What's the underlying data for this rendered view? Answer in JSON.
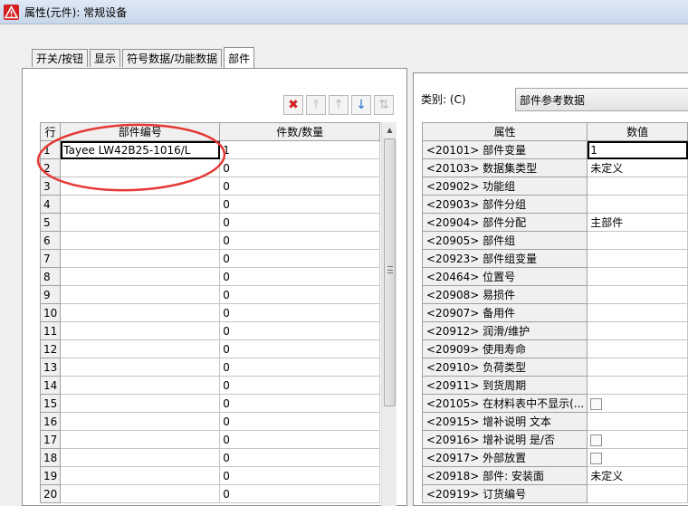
{
  "window": {
    "title": "属性(元件): 常规设备",
    "icon": "warning-triangle-app-icon"
  },
  "tabs": [
    {
      "label": "开关/按钮",
      "active": false
    },
    {
      "label": "显示",
      "active": false
    },
    {
      "label": "符号数据/功能数据",
      "active": false
    },
    {
      "label": "部件",
      "active": true
    }
  ],
  "toolbar": [
    {
      "icon": "delete-icon",
      "glyph": "✖",
      "enabled": true
    },
    {
      "icon": "move-to-top-icon",
      "glyph": "⤒",
      "enabled": false
    },
    {
      "icon": "move-up-icon",
      "glyph": "↑",
      "enabled": false
    },
    {
      "icon": "move-down-icon",
      "glyph": "↓",
      "enabled": true
    },
    {
      "icon": "swap-icon",
      "glyph": "⇅",
      "enabled": false
    }
  ],
  "parts_table": {
    "headers": [
      "行",
      "部件编号",
      "件数/数量"
    ],
    "rows": [
      [
        "1",
        "Tayee LW42B25-1016/L",
        "1"
      ],
      [
        "2",
        "",
        "0"
      ],
      [
        "3",
        "",
        "0"
      ],
      [
        "4",
        "",
        "0"
      ],
      [
        "5",
        "",
        "0"
      ],
      [
        "6",
        "",
        "0"
      ],
      [
        "7",
        "",
        "0"
      ],
      [
        "8",
        "",
        "0"
      ],
      [
        "9",
        "",
        "0"
      ],
      [
        "10",
        "",
        "0"
      ],
      [
        "11",
        "",
        "0"
      ],
      [
        "12",
        "",
        "0"
      ],
      [
        "13",
        "",
        "0"
      ],
      [
        "14",
        "",
        "0"
      ],
      [
        "15",
        "",
        "0"
      ],
      [
        "16",
        "",
        "0"
      ],
      [
        "17",
        "",
        "0"
      ],
      [
        "18",
        "",
        "0"
      ],
      [
        "19",
        "",
        "0"
      ],
      [
        "20",
        "",
        "0"
      ]
    ]
  },
  "category": {
    "label": "类别: (C)",
    "value": "部件参考数据"
  },
  "property_table": {
    "headers": [
      "属性",
      "数值"
    ],
    "rows": [
      {
        "prop": "<20101> 部件变量",
        "value": "1",
        "checkbox": false
      },
      {
        "prop": "<20103> 数据集类型",
        "value": "未定义",
        "checkbox": false
      },
      {
        "prop": "<20902> 功能组",
        "value": "",
        "checkbox": false
      },
      {
        "prop": "<20903> 部件分组",
        "value": "",
        "checkbox": false
      },
      {
        "prop": "<20904> 部件分配",
        "value": "主部件",
        "checkbox": false
      },
      {
        "prop": "<20905> 部件组",
        "value": "",
        "checkbox": false
      },
      {
        "prop": "<20923> 部件组变量",
        "value": "",
        "checkbox": false
      },
      {
        "prop": "<20464> 位置号",
        "value": "",
        "checkbox": false
      },
      {
        "prop": "<20908> 易损件",
        "value": "",
        "checkbox": false
      },
      {
        "prop": "<20907> 备用件",
        "value": "",
        "checkbox": false
      },
      {
        "prop": "<20912> 润滑/维护",
        "value": "",
        "checkbox": false
      },
      {
        "prop": "<20909> 使用寿命",
        "value": "",
        "checkbox": false
      },
      {
        "prop": "<20910> 负荷类型",
        "value": "",
        "checkbox": false
      },
      {
        "prop": "<20911> 到货周期",
        "value": "",
        "checkbox": false
      },
      {
        "prop": "<20105> 在材料表中不显示(...",
        "value": "",
        "checkbox": true
      },
      {
        "prop": "<20915> 增补说明 文本",
        "value": "",
        "checkbox": false
      },
      {
        "prop": "<20916> 增补说明 是/否",
        "value": "",
        "checkbox": true
      },
      {
        "prop": "<20917> 外部放置",
        "value": "",
        "checkbox": true
      },
      {
        "prop": "<20918> 部件: 安装面",
        "value": "未定义",
        "checkbox": false
      },
      {
        "prop": "<20919> 订货编号",
        "value": "",
        "checkbox": false
      }
    ]
  },
  "annotation": {
    "shape": "red-ellipse-highlight",
    "color": "#e53935"
  }
}
